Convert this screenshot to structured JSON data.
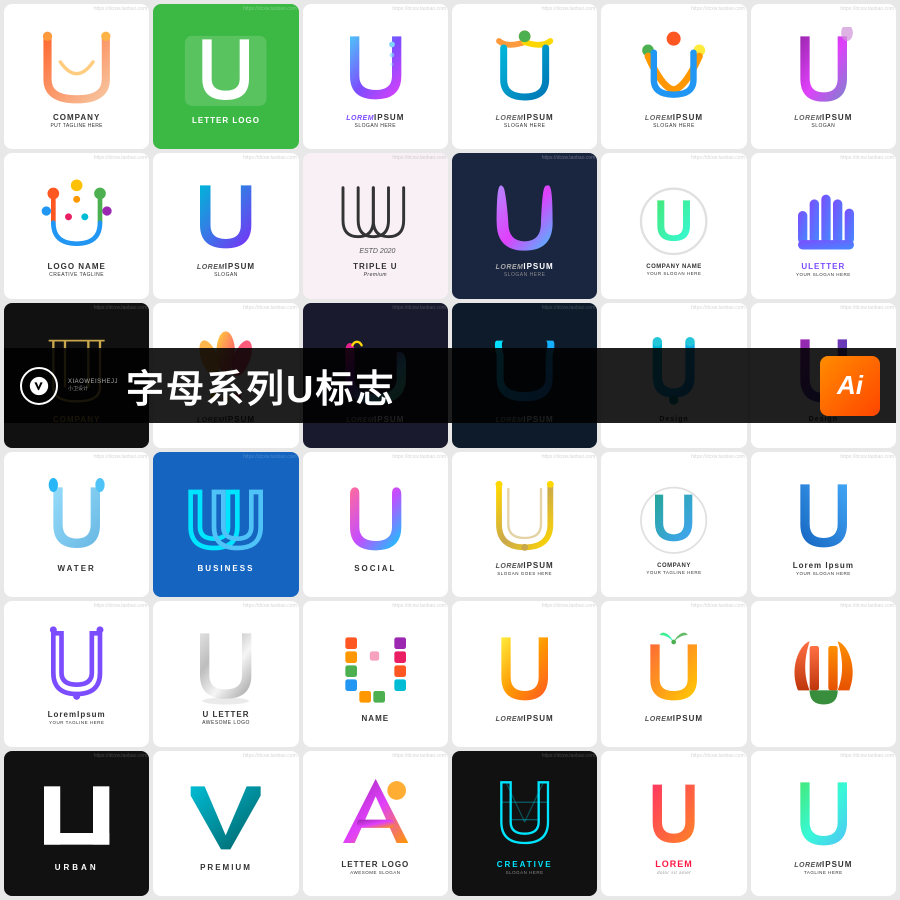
{
  "banner": {
    "title": "字母系列U标志",
    "logo_label": "W",
    "sub_label": "XIAOWEISHEJJ\n小卫设计",
    "ai_label": "Ai"
  },
  "watermark": "https://dcxw.taobao.com",
  "cells": [
    {
      "id": 1,
      "row": 1,
      "col": 1,
      "bg": "white",
      "label": "COMPANY",
      "sublabel": "PUT TAGLINE HERE"
    },
    {
      "id": 2,
      "row": 1,
      "col": 2,
      "bg": "green",
      "label": "LETTER LOGO",
      "sublabel": ""
    },
    {
      "id": 3,
      "row": 1,
      "col": 3,
      "bg": "white",
      "label": "LOREM IPSUM",
      "sublabel": "SLOGAN HERE"
    },
    {
      "id": 4,
      "row": 1,
      "col": 4,
      "bg": "white",
      "label": "LOREM IPSUM",
      "sublabel": "SLOGAN HERE"
    },
    {
      "id": 5,
      "row": 1,
      "col": 5,
      "bg": "white",
      "label": "LOREM IPSUM",
      "sublabel": "SLOGAN HERE"
    },
    {
      "id": 6,
      "row": 1,
      "col": 6,
      "bg": "white",
      "label": "LOREM IPSUM",
      "sublabel": "SLOGAN"
    },
    {
      "id": 7,
      "row": 2,
      "col": 1,
      "bg": "white",
      "label": "LOGO NAME",
      "sublabel": "CREATIVE TAGLINE"
    },
    {
      "id": 8,
      "row": 2,
      "col": 2,
      "bg": "white",
      "label": "LOREM IPSUM",
      "sublabel": "SLOGAN"
    },
    {
      "id": 9,
      "row": 2,
      "col": 3,
      "bg": "pink",
      "label": "TRIPLE U",
      "sublabel": "Premium"
    },
    {
      "id": 10,
      "row": 2,
      "col": 4,
      "bg": "navy",
      "label": "LOREM IPSUM",
      "sublabel": "SLOGAN HERE"
    },
    {
      "id": 11,
      "row": 2,
      "col": 5,
      "bg": "white",
      "label": "COMPANY NAME",
      "sublabel": "YOUR SLOGAN HERE"
    },
    {
      "id": 12,
      "row": 2,
      "col": 6,
      "bg": "white",
      "label": "ULETTER",
      "sublabel": "YOUR SLOGAN HERE"
    },
    {
      "id": 13,
      "row": 3,
      "col": 1,
      "bg": "black",
      "label": "COMPANY",
      "sublabel": ""
    },
    {
      "id": 14,
      "row": 3,
      "col": 2,
      "bg": "white",
      "label": "LOREM IPSUM",
      "sublabel": ""
    },
    {
      "id": 15,
      "row": 3,
      "col": 3,
      "bg": "dark",
      "label": "LOREM IPSUM",
      "sublabel": ""
    },
    {
      "id": 16,
      "row": 3,
      "col": 4,
      "bg": "dark",
      "label": "LOREM IPSUM",
      "sublabel": ""
    },
    {
      "id": 17,
      "row": 3,
      "col": 5,
      "bg": "white",
      "label": "Design",
      "sublabel": ""
    },
    {
      "id": 18,
      "row": 3,
      "col": 6,
      "bg": "white",
      "label": "Design",
      "sublabel": ""
    },
    {
      "id": 19,
      "row": 4,
      "col": 1,
      "bg": "white",
      "label": "WATER",
      "sublabel": ""
    },
    {
      "id": 20,
      "row": 4,
      "col": 2,
      "bg": "dark2",
      "label": "BUSINESS",
      "sublabel": ""
    },
    {
      "id": 21,
      "row": 4,
      "col": 3,
      "bg": "white",
      "label": "SOCIAL",
      "sublabel": ""
    },
    {
      "id": 22,
      "row": 4,
      "col": 4,
      "bg": "white",
      "label": "LOREM IPSUM",
      "sublabel": "SLOGAN GOES HERE"
    },
    {
      "id": 23,
      "row": 4,
      "col": 5,
      "bg": "white",
      "label": "COMPANY",
      "sublabel": "YOUR TAGLINE HERE"
    },
    {
      "id": 24,
      "row": 4,
      "col": 6,
      "bg": "white",
      "label": "Lorem Ipsum",
      "sublabel": "YOUR SLOGAN HERE"
    },
    {
      "id": 25,
      "row": 5,
      "col": 1,
      "bg": "white",
      "label": "LoremIpsum",
      "sublabel": "YOUR TAGLINE HERE"
    },
    {
      "id": 26,
      "row": 5,
      "col": 2,
      "bg": "white",
      "label": "U LETTER",
      "sublabel": "AWESOME LOGO"
    },
    {
      "id": 27,
      "row": 5,
      "col": 3,
      "bg": "white",
      "label": "NAME",
      "sublabel": ""
    },
    {
      "id": 28,
      "row": 5,
      "col": 4,
      "bg": "white",
      "label": "LOREM IPSUM",
      "sublabel": ""
    },
    {
      "id": 29,
      "row": 5,
      "col": 5,
      "bg": "white",
      "label": "LOREM IPSUM",
      "sublabel": ""
    },
    {
      "id": 30,
      "row": 5,
      "col": 6,
      "bg": "white",
      "label": "",
      "sublabel": ""
    },
    {
      "id": 31,
      "row": 6,
      "col": 1,
      "bg": "black",
      "label": "URBAN",
      "sublabel": ""
    },
    {
      "id": 32,
      "row": 6,
      "col": 2,
      "bg": "white",
      "label": "PREMIUM",
      "sublabel": ""
    },
    {
      "id": 33,
      "row": 6,
      "col": 3,
      "bg": "white",
      "label": "LETTER LOGO",
      "sublabel": "AWESOME SLOGAN"
    },
    {
      "id": 34,
      "row": 6,
      "col": 4,
      "bg": "black",
      "label": "CREATIVE",
      "sublabel": "SLOGAN HERE"
    },
    {
      "id": 35,
      "row": 6,
      "col": 5,
      "bg": "white",
      "label": "LOREM",
      "sublabel": "dolor sit amet"
    },
    {
      "id": 36,
      "row": 6,
      "col": 6,
      "bg": "white",
      "label": "LOREM IPSUM",
      "sublabel": "TAGLINE HERE"
    }
  ]
}
